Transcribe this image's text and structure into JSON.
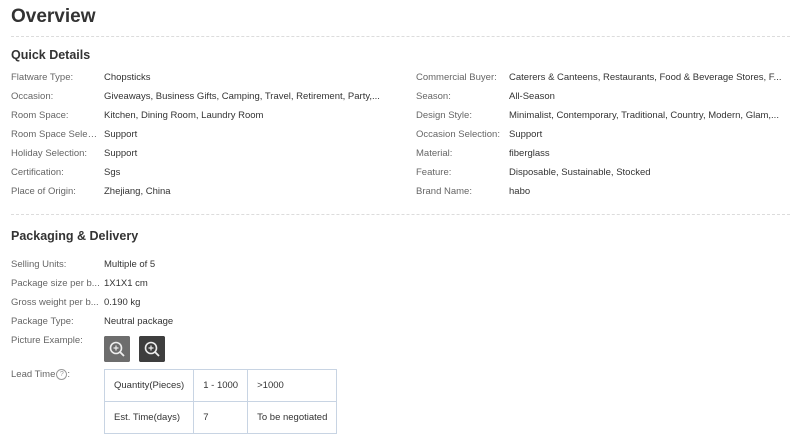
{
  "page": {
    "title": "Overview"
  },
  "quick_details": {
    "heading": "Quick Details",
    "left": [
      {
        "label": "Flatware Type:",
        "value": "Chopsticks"
      },
      {
        "label": "Occasion:",
        "value": "Giveaways, Business Gifts, Camping, Travel, Retirement, Party,..."
      },
      {
        "label": "Room Space:",
        "value": "Kitchen, Dining Room, Laundry Room"
      },
      {
        "label": "Room Space Select...",
        "value": "Support"
      },
      {
        "label": "Holiday Selection:",
        "value": "Support"
      },
      {
        "label": "Certification:",
        "value": "Sgs"
      },
      {
        "label": "Place of Origin:",
        "value": "Zhejiang, China"
      }
    ],
    "right": [
      {
        "label": "Commercial Buyer:",
        "value": "Caterers & Canteens, Restaurants, Food & Beverage Stores, F..."
      },
      {
        "label": "Season:",
        "value": "All-Season"
      },
      {
        "label": "Design Style:",
        "value": "Minimalist, Contemporary, Traditional, Country, Modern, Glam,..."
      },
      {
        "label": "Occasion Selection:",
        "value": "Support"
      },
      {
        "label": "Material:",
        "value": "fiberglass"
      },
      {
        "label": "Feature:",
        "value": "Disposable, Sustainable, Stocked"
      },
      {
        "label": "Brand Name:",
        "value": "habo"
      }
    ]
  },
  "packaging": {
    "heading": "Packaging & Delivery",
    "rows": [
      {
        "label": "Selling Units:",
        "value": "Multiple of 5"
      },
      {
        "label": "Package size per b...",
        "value": "1X1X1 cm"
      },
      {
        "label": "Gross weight per b...",
        "value": "0.190 kg"
      },
      {
        "label": "Package Type:",
        "value": "Neutral package"
      }
    ],
    "picture_label": "Picture Example:",
    "lead_time_label": "Lead Time",
    "lead_time_colon": ":",
    "help_glyph": "?",
    "lead_table": {
      "rows": [
        [
          "Quantity(Pieces)",
          "1 - 1000",
          ">1000"
        ],
        [
          "Est. Time(days)",
          "7",
          "To be negotiated"
        ]
      ]
    }
  },
  "icons": {
    "thumbnail_overlay": "zoom-in-icon",
    "help": "question-circle-icon"
  }
}
